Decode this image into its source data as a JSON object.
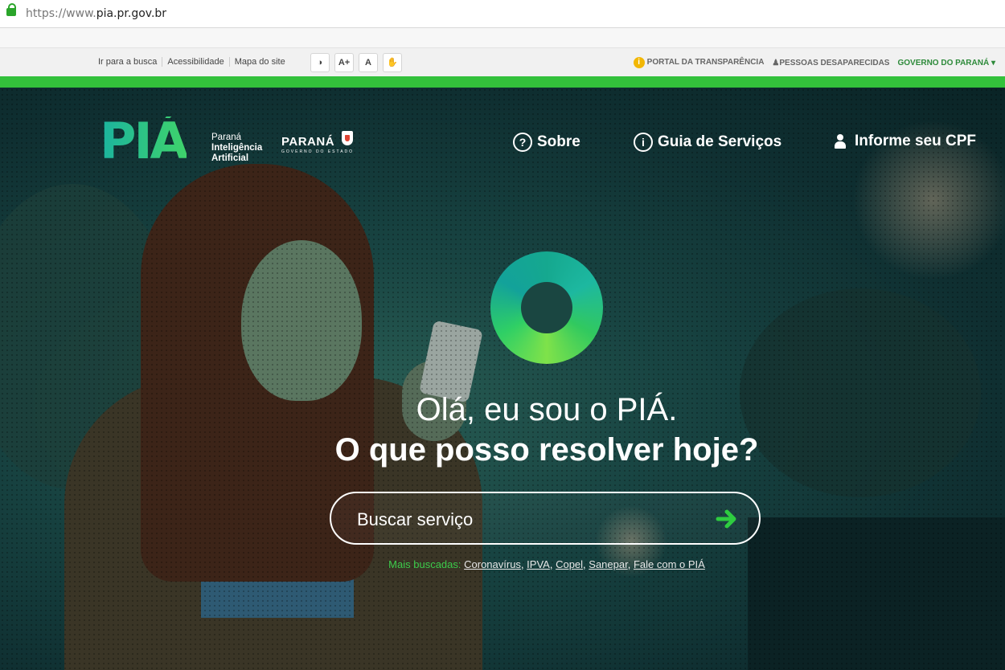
{
  "browser": {
    "url_proto": "https://www.",
    "url_host": "pia.pr.gov.br"
  },
  "govbar": {
    "links": [
      "Ir para a busca",
      "Acessibilidade",
      "Mapa do site"
    ],
    "a11y_buttons": [
      "◑",
      "A+",
      "A",
      "✋"
    ],
    "right": {
      "transparency": "PORTAL DA TRANSPARÊNCIA",
      "missing": "PESSOAS DESAPARECIDAS",
      "gov": "GOVERNO DO PARANÁ"
    }
  },
  "header": {
    "logo": "PIÁ",
    "logo_sub": [
      "Paraná",
      "Inteligência",
      "Artificial"
    ],
    "parana": "PARANÁ",
    "parana_sub": "GOVERNO DO ESTADO",
    "nav": {
      "about": "Sobre",
      "services": "Guia de Serviços",
      "cpf": "Informe seu CPF"
    }
  },
  "hero": {
    "greeting": "Olá, eu sou o PIÁ.",
    "question": "O que posso resolver hoje?",
    "search_placeholder": "Buscar serviço",
    "popular_label": "Mais buscadas:",
    "popular": [
      "Coronavírus",
      "IPVA",
      "Copel",
      "Sanepar",
      "Fale com o PIÁ"
    ]
  },
  "colors": {
    "accent_green": "#33c13b",
    "hero_bg": "#0f2f31",
    "gov_link": "#2d8a3a"
  },
  "icons": [
    "lock-icon",
    "help-circle-icon",
    "info-circle-icon",
    "user-icon",
    "arrow-right-icon",
    "info-icon",
    "person-icon",
    "caret-down-icon"
  ]
}
